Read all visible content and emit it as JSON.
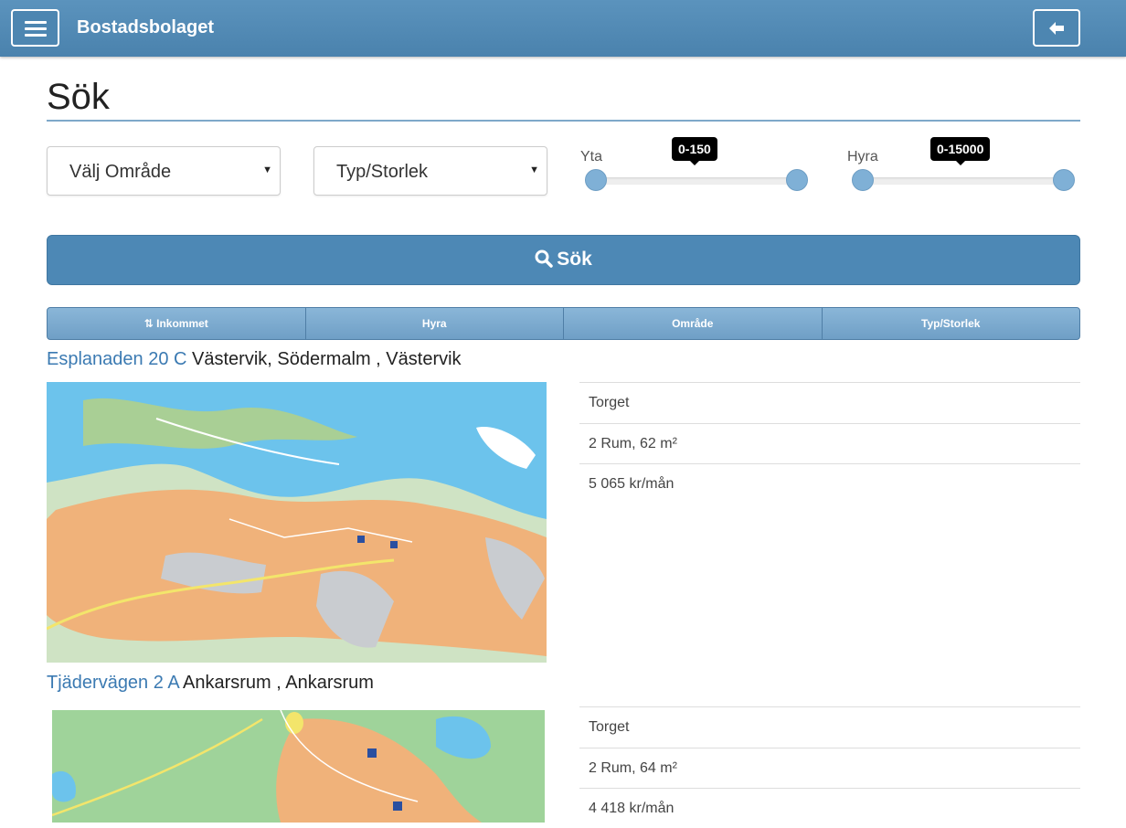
{
  "header": {
    "title": "Bostadsbolaget"
  },
  "page_title": "Sök",
  "filters": {
    "area_select": "Välj Område",
    "type_select": "Typ/Storlek",
    "area_slider": {
      "label": "Yta",
      "value": "0-150"
    },
    "rent_slider": {
      "label": "Hyra",
      "value": "0-15000"
    }
  },
  "search_button": "Sök",
  "sort": {
    "inkommet": "Inkommet",
    "hyra": "Hyra",
    "omrade": "Område",
    "typ": "Typ/Storlek"
  },
  "listings": [
    {
      "address": "Esplanaden 20 C",
      "location": " Västervik, Södermalm , Västervik",
      "seller": "Torget",
      "size": "2 Rum, 62 m²",
      "rent": "5 065 kr/mån"
    },
    {
      "address": "Tjädervägen 2 A",
      "location": " Ankarsrum , Ankarsrum",
      "seller": "Torget",
      "size": "2 Rum, 64 m²",
      "rent": "4 418 kr/mån"
    }
  ],
  "colors": {
    "header": "#4a82ad",
    "accent": "#3b7ab2",
    "button": "#4d88b5"
  }
}
